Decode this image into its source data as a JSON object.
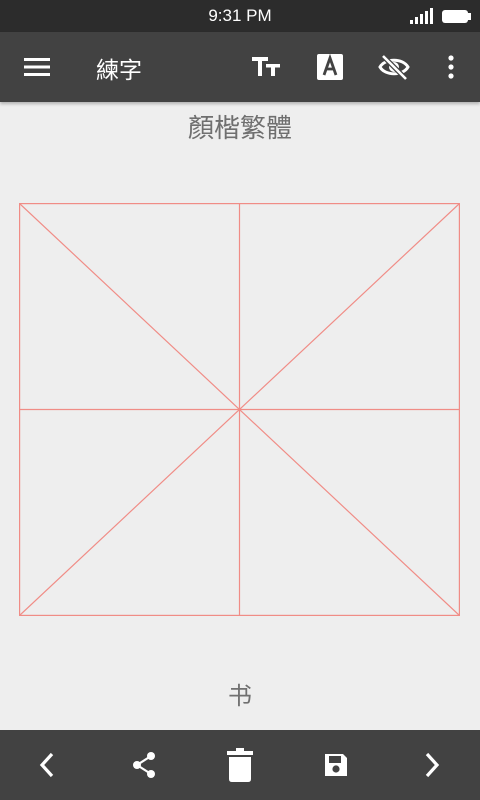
{
  "status_bar": {
    "time": "9:31 PM",
    "battery_icon": "battery-icon",
    "signal_icon": "signal-icon"
  },
  "toolbar": {
    "menu_icon": "menu-icon",
    "title": "練字",
    "actions": [
      "text-size-icon",
      "font-icon",
      "visibility-off-icon",
      "more-vert-icon"
    ]
  },
  "practice": {
    "font_name": "顏楷繁體",
    "character_label": "书",
    "grid_color": "#f08c86"
  },
  "bottom_bar": {
    "actions": [
      "previous-icon",
      "share-icon",
      "delete-icon",
      "save-icon",
      "next-icon"
    ]
  },
  "colors": {
    "toolbar_bg": "#424242",
    "status_bg": "#2c2c2c",
    "canvas_bg": "#eeeeee"
  }
}
